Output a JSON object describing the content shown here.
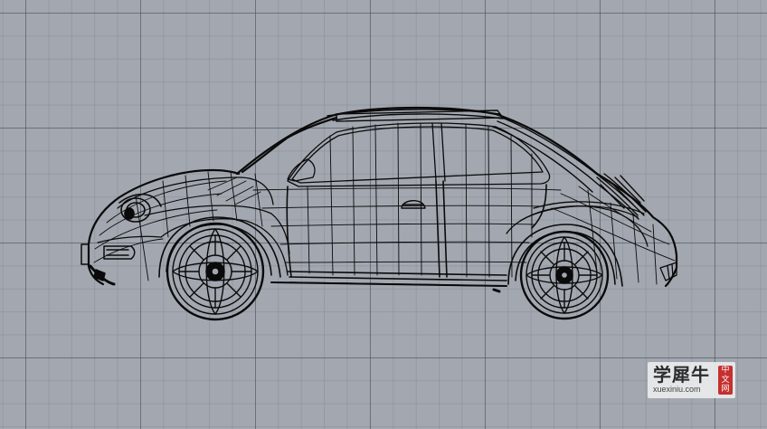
{
  "viewport": {
    "background_color": "#a3a8b0",
    "grid_major_color": "#4e5460",
    "grid_minor_color": "#787e88",
    "wire_color": "#0a0a0a"
  },
  "model": {
    "subject": "car-wireframe"
  },
  "watermark": {
    "main": "学犀牛",
    "url": "xuexiniu.com",
    "seal": "中文网"
  }
}
